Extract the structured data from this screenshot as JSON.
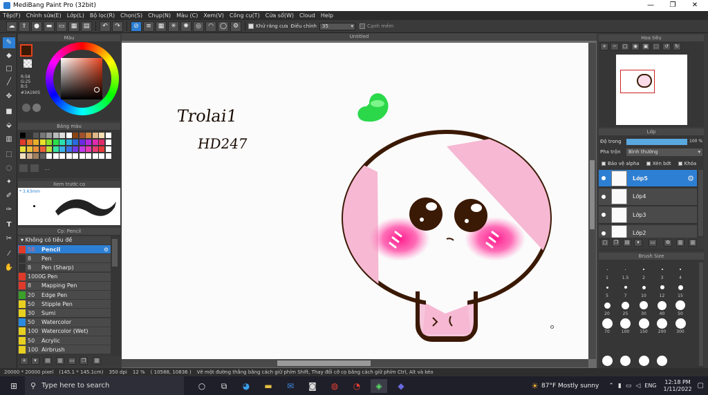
{
  "window": {
    "title": "MediBang Paint Pro (32bit)",
    "minimize": "—",
    "maximize": "❐",
    "close": "✕"
  },
  "menu": [
    "Tệp(F)",
    "Chỉnh sửa(E)",
    "Lớp(L)",
    "Bộ lọc(R)",
    "Chọn(S)",
    "Chụp(N)",
    "Màu (C)",
    "Xem(V)",
    "Công cụ(T)",
    "Cửa sổ(W)",
    "Cloud",
    "Help"
  ],
  "toolbar": {
    "antialias_label": "Khử răng cưa",
    "correction_label": "Điều chỉnh",
    "correction_value": "35",
    "edge_label": "Cạnh mềm"
  },
  "color_panel": {
    "title": "Màu",
    "r": "R:58",
    "g": "G:25",
    "b": "B:5",
    "hex": "#3A1905",
    "foreground": "#3A1905",
    "accent": "#e8431c"
  },
  "palette_panel": {
    "title": "Bảng màu",
    "more": "..."
  },
  "brush_preview": {
    "title": "Xem trước cọ",
    "size": "* 3.63mm"
  },
  "brush_panel": {
    "title": "Cọ: Pencil",
    "group": "Không có tiêu đề",
    "items": [
      {
        "size": "58",
        "name": "Pencil",
        "color": "#e03a2a",
        "selected": true
      },
      {
        "size": "8",
        "name": "Pen",
        "color": "#333333"
      },
      {
        "size": "8",
        "name": "Pen (Sharp)",
        "color": "#333333"
      },
      {
        "size": "1000",
        "name": "G Pen",
        "color": "#e03a2a"
      },
      {
        "size": "8",
        "name": "Mapping Pen",
        "color": "#e03a2a"
      },
      {
        "size": "20",
        "name": "Edge Pen",
        "color": "#3aa02a"
      },
      {
        "size": "50",
        "name": "Stipple Pen",
        "color": "#e8d020"
      },
      {
        "size": "30",
        "name": "Sumi",
        "color": "#e8d020"
      },
      {
        "size": "50",
        "name": "Watercolor",
        "color": "#2a8ae0"
      },
      {
        "size": "100",
        "name": "Watercolor (Wet)",
        "color": "#e8d020"
      },
      {
        "size": "50",
        "name": "Acrylic",
        "color": "#e8d020"
      },
      {
        "size": "100",
        "name": "Airbrush",
        "color": "#e8d020"
      }
    ]
  },
  "canvas": {
    "tab": "Untitled",
    "text_line1": "Trolai1",
    "text_line2": "HD247"
  },
  "navigator": {
    "title": "Hoa tiêu"
  },
  "layer_panel": {
    "title": "Lớp",
    "opacity_label": "Độ trong",
    "opacity_value": "100 %",
    "opacity_fraction": 1.0,
    "blend_label": "Pha trộn",
    "blend_value": "Bình thường",
    "protect_alpha": "Bảo vệ alpha",
    "clipping": "Xén bớt",
    "lock": "Khóa",
    "layers": [
      {
        "name": "Lớp5",
        "selected": true
      },
      {
        "name": "Lớp4"
      },
      {
        "name": "Lớp3"
      },
      {
        "name": "Lớp2"
      }
    ]
  },
  "brush_size": {
    "title": "Brush Size",
    "sizes": [
      "1",
      "1.5",
      "2",
      "3",
      "4",
      "5",
      "7",
      "10",
      "12",
      "15",
      "20",
      "25",
      "30",
      "40",
      "50",
      "70",
      "100",
      "150",
      "200",
      "300"
    ]
  },
  "status": {
    "dimensions": "20000 * 20000 pixel",
    "size_cm": "(145.1 * 145.1cm)",
    "dpi": "350 dpi",
    "zoom": "12 %",
    "coords": "( 10588, 10836 )",
    "hint": "Vẽ một đường thẳng bằng cách giữ phím Shift, Thay đổi cỡ cọ bằng cách giữ phím Ctrl, Alt và kéo"
  },
  "taskbar": {
    "search_placeholder": "Type here to search",
    "weather": "87°F  Mostly sunny",
    "lang": "ENG",
    "time": "12:18 PM",
    "date": "1/11/2022"
  }
}
